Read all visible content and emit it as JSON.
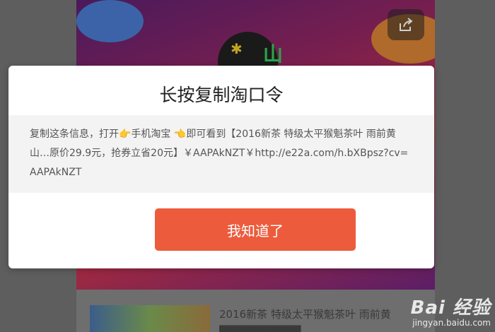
{
  "dialog": {
    "title": "长按复制淘口令",
    "message": "复制这条信息，打开👉手机淘宝 👈即可看到【2016新茶 特级太平猴魁茶叶 雨前黄山…原价29.9元，抢券立省20元】￥AAPAkNZT￥http://e22a.com/h.bXBpsz?cv=AAPAkNZT",
    "confirm_label": "我知道了"
  },
  "background": {
    "logo_text": "山",
    "product_title": "2016新茶 特级太平猴魁茶叶 雨前黄",
    "share_icon": "share-icon"
  },
  "watermark": {
    "logo": "Bai 经验",
    "url": "jingyan.baidu.com"
  },
  "colors": {
    "confirm_button": "#ec5b3c",
    "dialog_bg": "#ffffff",
    "message_bg": "#f3f3f3"
  }
}
